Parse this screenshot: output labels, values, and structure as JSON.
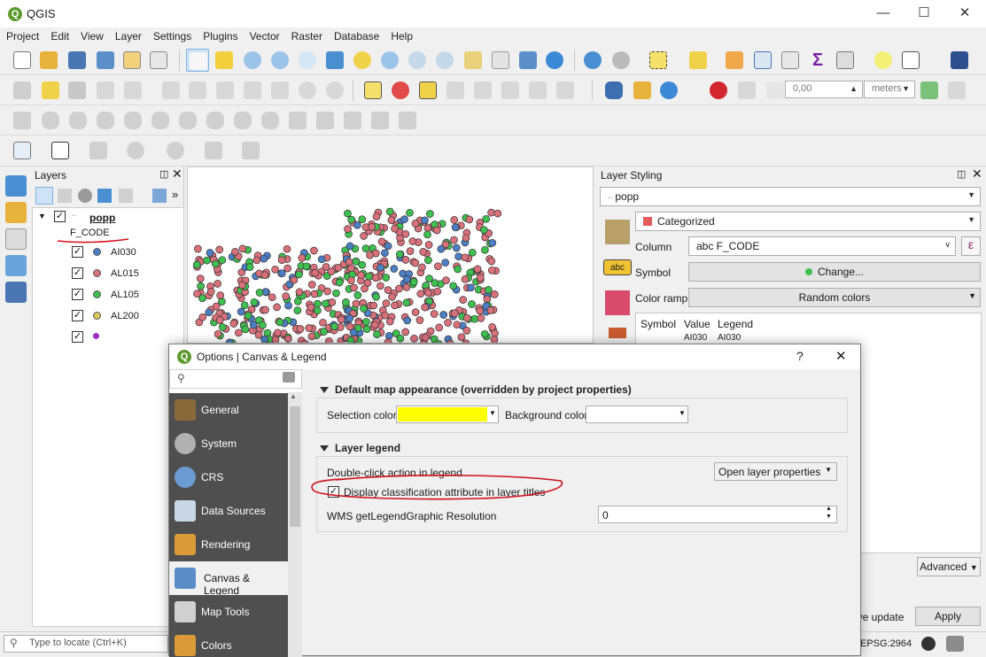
{
  "window": {
    "title": "QGIS",
    "logo": "Q"
  },
  "menu": [
    "Project",
    "Edit",
    "View",
    "Layer",
    "Settings",
    "Plugins",
    "Vector",
    "Raster",
    "Database",
    "Help"
  ],
  "toolbar": {
    "scale_value": "0,00",
    "units": "meters"
  },
  "layers_panel": {
    "title": "Layers",
    "layer_name": "popp",
    "attribute_title": "F_CODE",
    "classes": [
      {
        "label": "AI030",
        "color": "#4d7fc4"
      },
      {
        "label": "AL015",
        "color": "#d9717b"
      },
      {
        "label": "AL105",
        "color": "#3fbf4f"
      },
      {
        "label": "AL200",
        "color": "#d8c85a"
      },
      {
        "label": "",
        "color": "#9b2fc4"
      }
    ]
  },
  "styling_panel": {
    "title": "Layer Styling",
    "layer": "popp",
    "renderer": "Categorized",
    "column_label": "Column",
    "column_value": "abc F_CODE",
    "symbol_label": "Symbol",
    "symbol_button": "Change...",
    "color_ramp_label": "Color ramp",
    "color_ramp_value": "Random colors",
    "table_headers": [
      "Symbol",
      "Value",
      "Legend"
    ],
    "first_row": {
      "value": "AI030",
      "legend": "AI030"
    },
    "advanced_button": "Advanced",
    "live_update": "ive update",
    "apply_button": "Apply"
  },
  "statusbar": {
    "locate_placeholder": "Type to locate (Ctrl+K)",
    "crs": "EPSG:2964"
  },
  "dialog": {
    "title": "Options | Canvas & Legend",
    "help": "?",
    "close": "✕",
    "nav": [
      {
        "label": "General",
        "icon": "general-icon",
        "selected": false
      },
      {
        "label": "System",
        "icon": "system-icon",
        "selected": false
      },
      {
        "label": "CRS",
        "icon": "crs-icon",
        "selected": false
      },
      {
        "label": "Data Sources",
        "icon": "data-sources-icon",
        "selected": false
      },
      {
        "label": "Rendering",
        "icon": "rendering-icon",
        "selected": false
      },
      {
        "label": "Canvas & Legend",
        "icon": "canvas-legend-icon",
        "selected": true
      },
      {
        "label": "Map Tools",
        "icon": "map-tools-icon",
        "selected": false
      },
      {
        "label": "Colors",
        "icon": "colors-icon",
        "selected": false
      }
    ],
    "section1": {
      "title": "Default map appearance (overridden by project properties)",
      "selection_color_label": "Selection color",
      "selection_color": "#ffff00",
      "background_color_label": "Background color",
      "background_color": "#ffffff"
    },
    "section2": {
      "title": "Layer legend",
      "double_click_label": "Double-click action in legend",
      "double_click_value": "Open layer properties",
      "display_class_attr_label": "Display classification attribute in layer titles",
      "display_class_attr_checked": true,
      "wms_label": "WMS getLegendGraphic Resolution",
      "wms_value": "0"
    }
  },
  "annotation_color": "#d0101a"
}
